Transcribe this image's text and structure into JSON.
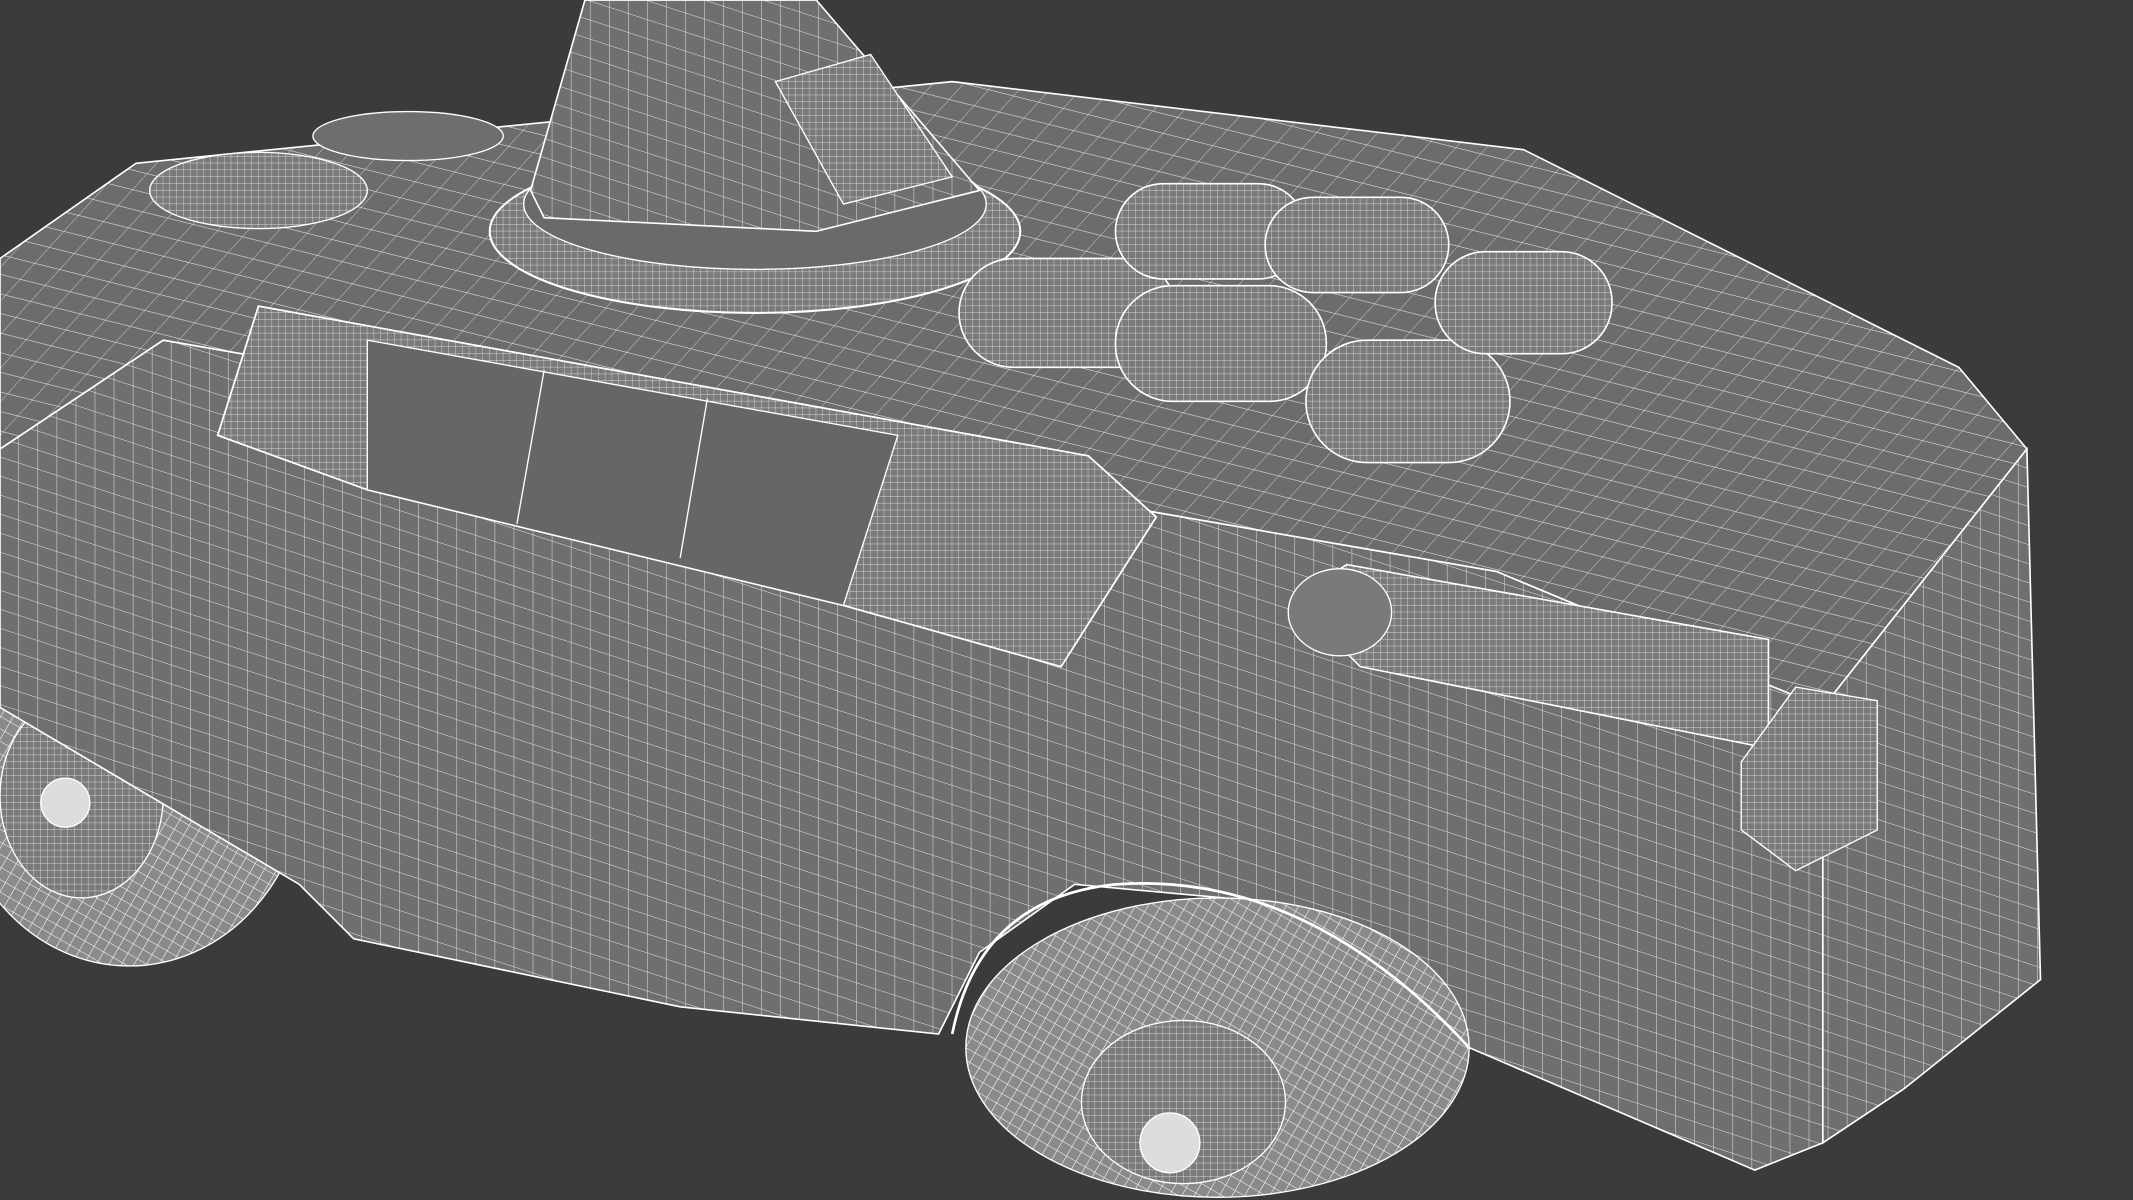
{
  "scene": {
    "background_color": "#3b3b3b",
    "mesh_color": "#6f6f6f",
    "mesh_dark_color": "#5e5e5e",
    "wire_color": "#f2f2f2",
    "parts": [
      "hull",
      "turret",
      "hatches",
      "side-panel",
      "wheels",
      "exhaust",
      "fuel-pods"
    ]
  }
}
